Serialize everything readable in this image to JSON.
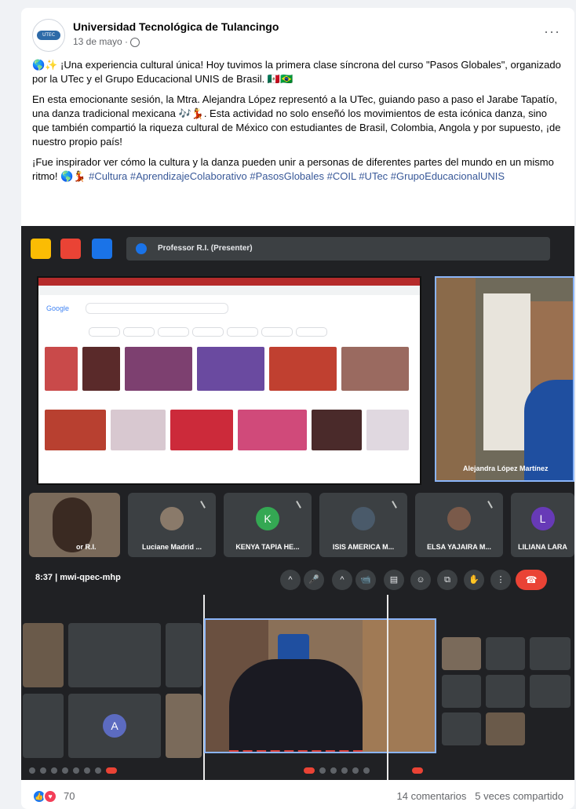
{
  "post": {
    "page_name": "Universidad Tecnológica de Tulancingo",
    "date": "13 de mayo ·",
    "more": "···",
    "logo_text": "UTEC",
    "paragraphs": [
      "🌎✨ ¡Una experiencia cultural única! Hoy tuvimos la primera clase síncrona del curso \"Pasos Globales\", organizado por la UTec y el Grupo Educacional UNIS de Brasil. 🇲🇽🇧🇷",
      "En esta emocionante sesión, la Mtra. Alejandra López representó a la UTec, guiando paso a paso el Jarabe Tapatío, una danza tradicional mexicana 🎶💃. Esta actividad no solo enseñó los movimientos de esta icónica danza, sino que también compartió la riqueza cultural de México con estudiantes de Brasil, Colombia, Angola y por supuesto, ¡de nuestro propio país!"
    ],
    "last_paragraph_text": "¡Fue inspirador ver cómo la cultura y la danza pueden unir a personas de diferentes partes del mundo en un mismo ritmo! 🌎💃 ",
    "hashtags": "#Cultura #AprendizajeColaborativo #PasosGlobales #COIL #UTec #GrupoEducacionalUNIS"
  },
  "meeting": {
    "presenter_label": "Professor R.I. (Presenter)",
    "google_logo": "Google",
    "main_cam_name": "Alejandra López Martínez",
    "self_tile_name": "or R.I.",
    "tiles": [
      {
        "name": "Luciane Madrid ...",
        "initial": "",
        "color": "#5f6368"
      },
      {
        "name": "KENYA TAPIA HE...",
        "initial": "K",
        "color": "#34a853"
      },
      {
        "name": "ISIS AMERICA M...",
        "initial": "",
        "color": "#5f6368"
      },
      {
        "name": "ELSA YAJAIRA M...",
        "initial": "",
        "color": "#5f6368"
      },
      {
        "name": "LILIANA LARA",
        "initial": "L",
        "color": "#673ab7"
      }
    ],
    "meet_code": "8:37  |  mwi-qpec-mhp",
    "controls": [
      "^",
      "🎤",
      "^",
      "📹",
      "▤",
      "☺",
      "⧉",
      "✋",
      "⋮"
    ],
    "hangup": "☎",
    "second_shot_initial": "A"
  },
  "footer": {
    "reaction_count": "70",
    "comments": "14 comentarios",
    "shares": "5 veces compartido",
    "like_icon": "👍",
    "love_icon": "♥"
  },
  "colors": {
    "facebook_blue": "#1877f2",
    "hashtag": "#385898",
    "meet_bg": "#202124",
    "hangup_red": "#ea4335"
  }
}
